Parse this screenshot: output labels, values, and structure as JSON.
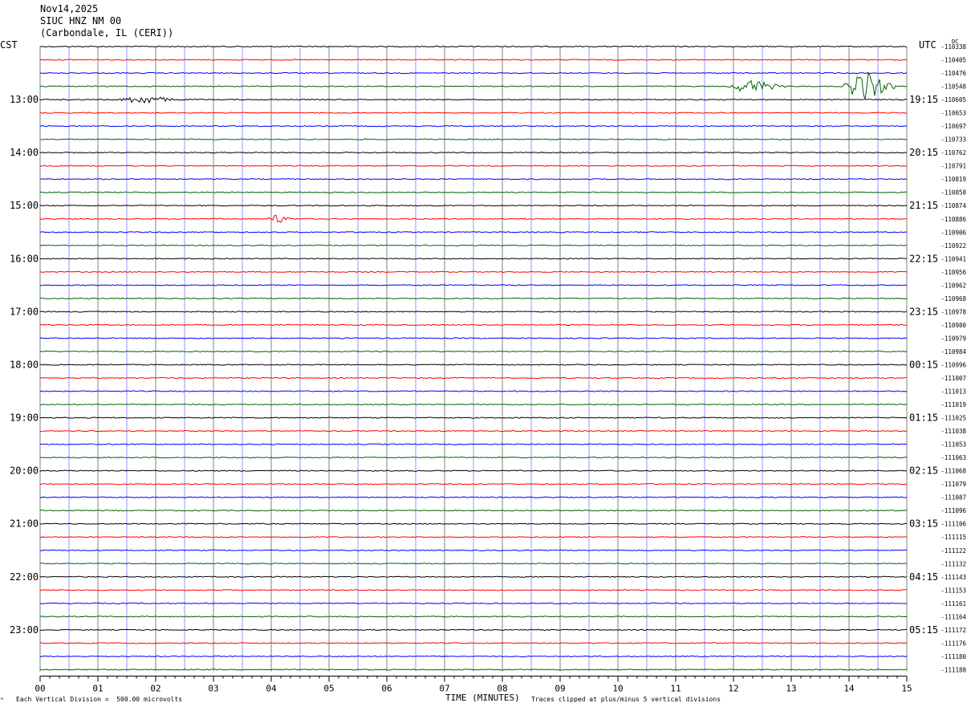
{
  "header": {
    "date": "Nov14,2025",
    "station": "SIUC HNZ NM 00",
    "location": "(Carbondale, IL (CERI))"
  },
  "left_tz": "CST",
  "right_tz": "UTC",
  "dc_label": "DC",
  "footer": {
    "scale_note": "Each Vertical Division =  500.00 microvolts",
    "x_title": "TIME (MINUTES)",
    "clip_note": "Traces clipped at plus/minus 5 vertical divisions"
  },
  "colors": {
    "trace_cycle": [
      "#000000",
      "#ff0000",
      "#0000ff",
      "#006400"
    ],
    "minute_grid": "#808080",
    "blue_grid": "#0000ff"
  },
  "chart_data": {
    "type": "line",
    "title": "SIUC HNZ NM 00",
    "xlabel": "TIME (MINUTES)",
    "xlim": [
      0,
      15
    ],
    "x_ticks": [
      "00",
      "01",
      "02",
      "03",
      "04",
      "05",
      "06",
      "07",
      "08",
      "09",
      "10",
      "11",
      "12",
      "13",
      "14",
      "15"
    ],
    "left_hour_labels": [
      "13:00",
      "14:00",
      "15:00",
      "16:00",
      "17:00",
      "18:00",
      "19:00",
      "20:00",
      "21:00",
      "22:00",
      "23:00"
    ],
    "right_hour_labels": [
      "19:15",
      "20:15",
      "21:15",
      "22:15",
      "23:15",
      "00:15",
      "01:15",
      "02:15",
      "03:15",
      "04:15",
      "05:15"
    ],
    "dc_offsets": [
      "-110338",
      "-110405",
      "-110476",
      "-110548",
      "-110605",
      "-110653",
      "-110697",
      "-110733",
      "-110762",
      "-110791",
      "-110819",
      "-110858",
      "-110874",
      "-110886",
      "-110906",
      "-110922",
      "-110941",
      "-110956",
      "-110962",
      "-110968",
      "-110978",
      "-110980",
      "-110979",
      "-110984",
      "-110996",
      "-111007",
      "-111013",
      "-111019",
      "-111025",
      "-111038",
      "-111053",
      "-111063",
      "-111068",
      "-111079",
      "-111087",
      "-111096",
      "-111106",
      "-111115",
      "-111122",
      "-111132",
      "-111143",
      "-111153",
      "-111161",
      "-111164",
      "-111172",
      "-111176",
      "-111180",
      "-111188"
    ],
    "events": [
      {
        "row": 3,
        "start_min": 11.9,
        "end_min": 12.9,
        "peak": 0.6
      },
      {
        "row": 3,
        "start_min": 13.9,
        "end_min": 14.8,
        "peak": 1.3
      },
      {
        "row": 4,
        "start_min": 1.3,
        "end_min": 2.5,
        "peak": 0.35
      },
      {
        "row": 13,
        "start_min": 3.9,
        "end_min": 4.4,
        "peak": 0.4
      }
    ]
  }
}
